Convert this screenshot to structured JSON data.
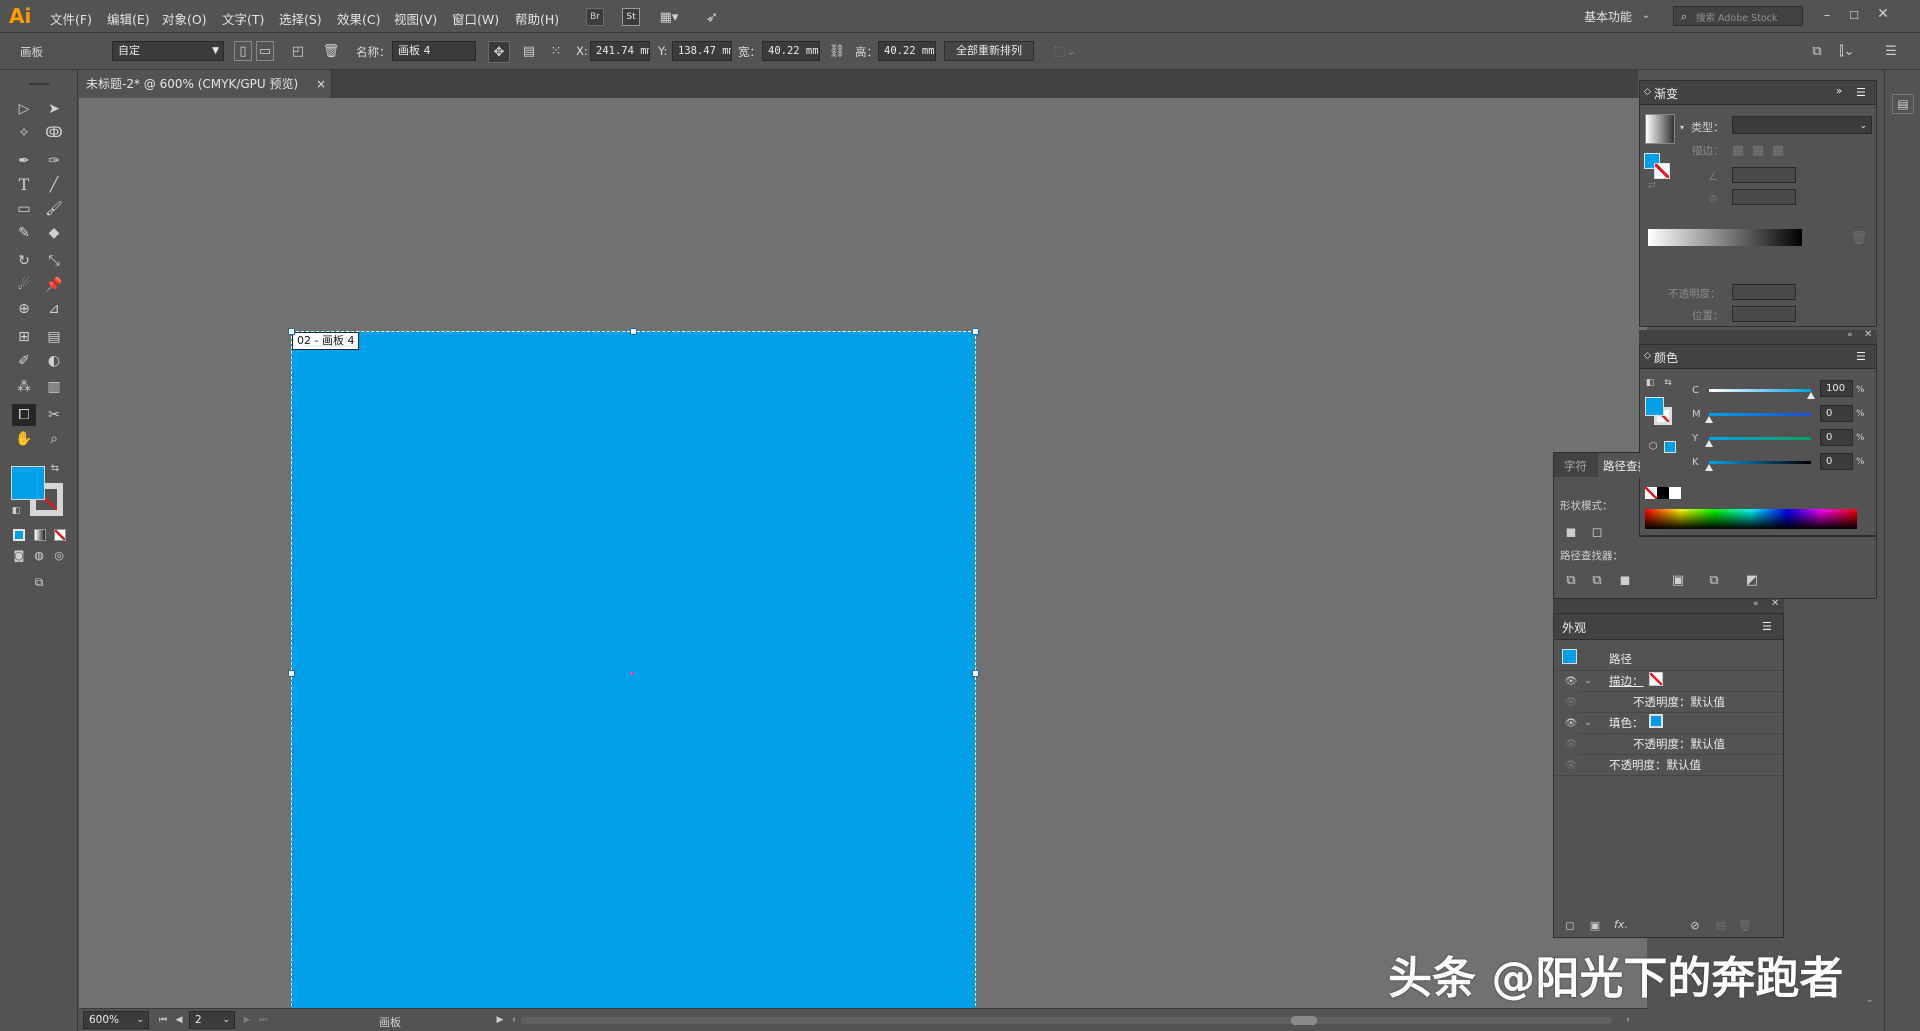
{
  "app": {
    "logo": "Ai"
  },
  "menu": [
    "文件(F)",
    "编辑(E)",
    "对象(O)",
    "文字(T)",
    "选择(S)",
    "效果(C)",
    "视图(V)",
    "窗口(W)",
    "帮助(H)"
  ],
  "topbar": {
    "br_icon": "Br",
    "st_icon": "St",
    "workspace": "基本功能",
    "search_placeholder": "搜索 Adobe Stock"
  },
  "control": {
    "panel_label": "画板",
    "preset": "自定",
    "name_label": "名称：",
    "name_value": "画板 4",
    "x_label": "X:",
    "x_value": "241.74 mm",
    "y_label": "Y:",
    "y_value": "138.47 mm",
    "w_label": "宽：",
    "w_value": "40.22 mm",
    "h_label": "高：",
    "h_value": "40.22 mm",
    "rearrange_button": "全部重新排列"
  },
  "document_tab": {
    "title": "未标题-2* @ 600% (CMYK/GPU 预览)",
    "close": "×"
  },
  "artboard": {
    "label": "02 - 画板 4",
    "fill_color": "#00a0e9"
  },
  "status": {
    "zoom": "600%",
    "page": "2",
    "label": "画板"
  },
  "gradient_panel": {
    "title": "渐变",
    "type_label": "类型：",
    "stroke_label": "描边：",
    "opacity_label": "不透明度：",
    "location_label": "位置："
  },
  "color_panel": {
    "title": "颜色",
    "channels": [
      {
        "label": "C",
        "value": "100",
        "fraction": 1.0
      },
      {
        "label": "M",
        "value": "0",
        "fraction": 0.0
      },
      {
        "label": "Y",
        "value": "0",
        "fraction": 0.0
      },
      {
        "label": "K",
        "value": "0",
        "fraction": 0.0
      }
    ],
    "percent": "%"
  },
  "pathfinder_panel": {
    "tab_char": "字符",
    "tab_pathfinder": "路径查找器",
    "shape_modes": "形状模式：",
    "pathfinders": "路径查找器："
  },
  "appearance_panel": {
    "title": "外观",
    "object": "路径",
    "stroke_label": "描边：",
    "stroke_opacity": "不透明度：默认值",
    "fill_label": "填色：",
    "fill_opacity": "不透明度：默认值",
    "opacity": "不透明度：默认值",
    "fx": "fx."
  },
  "watermark": "头条 @阳光下的奔跑者"
}
